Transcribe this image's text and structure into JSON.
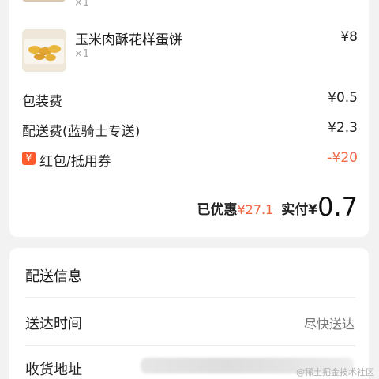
{
  "order": {
    "prev_item": {
      "qty": "×1"
    },
    "item": {
      "name": "玉米肉酥花样蛋饼",
      "qty": "×1",
      "price": "¥8"
    },
    "fees": [
      {
        "label": "包装费",
        "value": "¥0.5"
      },
      {
        "label": "配送费(蓝骑士专送)",
        "value": "¥2.3"
      }
    ],
    "coupon": {
      "icon_text": "¥",
      "label": "红包/抵用券",
      "value": "-¥20"
    },
    "summary": {
      "discount_label": "已优惠",
      "discount_value": "¥27.1",
      "paid_label": "实付",
      "paid_currency": "¥",
      "paid_value": "0.7"
    }
  },
  "delivery": {
    "title": "配送信息",
    "rows": [
      {
        "label": "送达时间",
        "value": "尽快送达"
      },
      {
        "label": "收货地址",
        "value": ""
      }
    ]
  },
  "watermark": "@稀土掘金技术社区",
  "colors": {
    "accent": "#f0653f",
    "coupon_icon": "#ff5a2c",
    "background": "#f2f2f2",
    "card": "#ffffff"
  },
  "icons": {
    "coupon": "coupon-yuan-icon"
  }
}
